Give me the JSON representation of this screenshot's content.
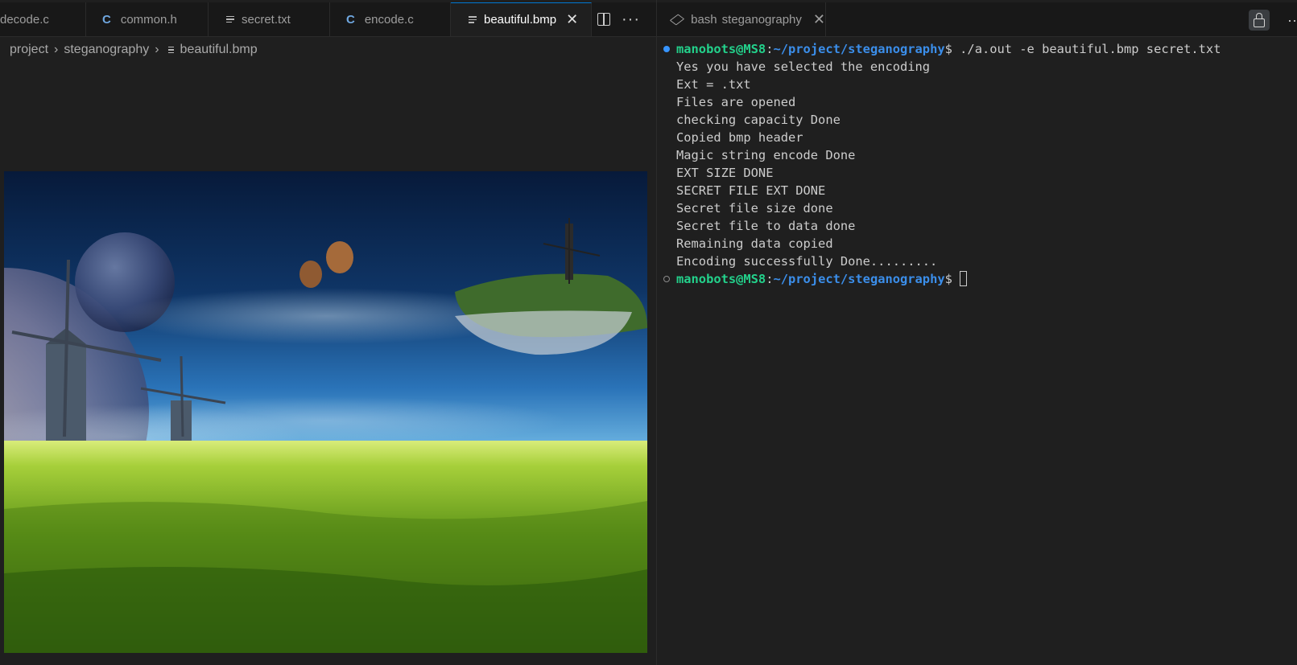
{
  "editor": {
    "tabs": [
      {
        "label": "decode.c",
        "icon": "c-file-icon"
      },
      {
        "label": "common.h",
        "icon": "c-file-icon"
      },
      {
        "label": "secret.txt",
        "icon": "text-file-icon"
      },
      {
        "label": "encode.c",
        "icon": "c-file-icon"
      },
      {
        "label": "beautiful.bmp",
        "icon": "text-file-icon",
        "active": true
      }
    ],
    "breadcrumb": [
      "project",
      "steganography",
      "beautiful.bmp"
    ],
    "image_alt": "beautiful.bmp preview: windmills, planets, hot air balloons and a floating island above a green wheat field"
  },
  "terminal": {
    "tab_label": "bash",
    "tab_folder": "steganography",
    "prompt_user": "manobots@MS8",
    "prompt_sep": ":",
    "prompt_path": "~/project/steganography",
    "prompt_symbol": "$",
    "command": " ./a.out -e beautiful.bmp secret.txt",
    "output": [
      "Yes you have selected the encoding",
      "Ext = .txt",
      "Files are opened",
      "checking capacity Done",
      "Copied bmp header",
      "Magic string encode Done",
      "EXT SIZE DONE",
      "SECRET FILE EXT DONE",
      "Secret file size done",
      "Secret file to data done",
      "Remaining data copied",
      "Encoding successfully Done........."
    ]
  },
  "colors": {
    "accent": "#0078d4",
    "prompt_user": "#23d18b",
    "prompt_path": "#3b8eea",
    "background": "#1f1f1f"
  }
}
